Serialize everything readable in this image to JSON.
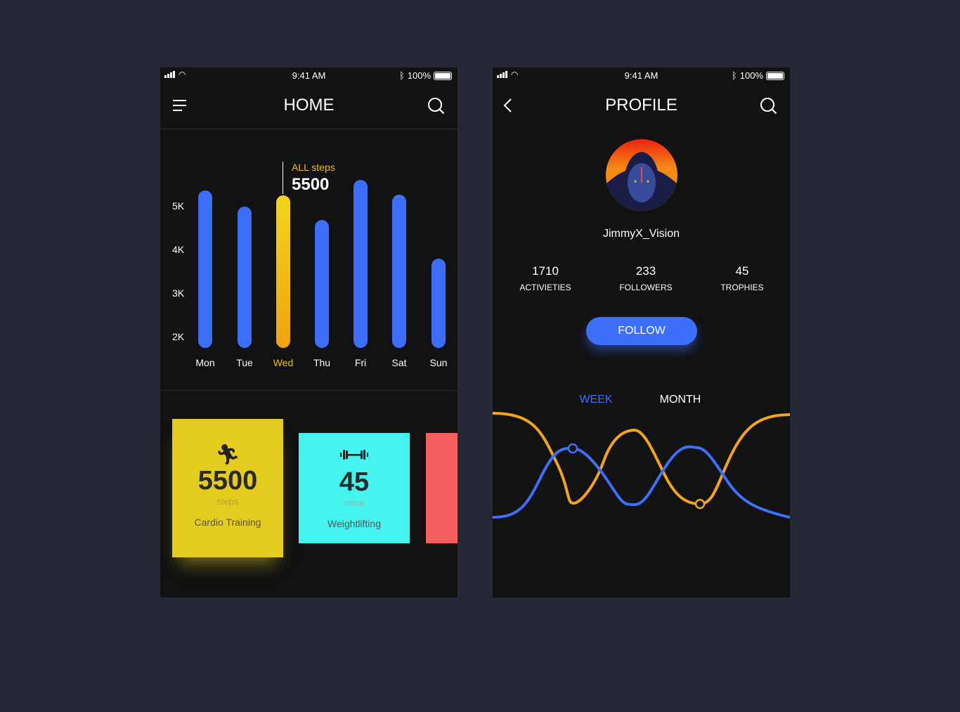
{
  "status_bar": {
    "time": "9:41 AM",
    "battery": "100%"
  },
  "home": {
    "title": "HOME",
    "chart_data": {
      "type": "bar",
      "categories": [
        "Mon",
        "Tue",
        "Wed",
        "Thu",
        "Fri",
        "Sat",
        "Sun"
      ],
      "values": [
        5370,
        5000,
        5260,
        4690,
        5610,
        5270,
        3800
      ],
      "y_ticks": [
        "5K",
        "4K",
        "3K",
        "2K"
      ],
      "ylim": [
        1750,
        6000
      ],
      "highlight_index": 2,
      "highlight_color": "#f2c014",
      "bar_color": "#3e6ffb",
      "tooltip": {
        "label": "ALL steps",
        "value": "5500"
      }
    },
    "cards": [
      {
        "icon": "running-icon",
        "value": "5500",
        "unit": "steps",
        "label": "Cardio Training",
        "color": "#e4cc1e"
      },
      {
        "icon": "dumbbell-icon",
        "value": "45",
        "unit": "mins",
        "label": "Weightlifting",
        "color": "#45f4ee"
      },
      {
        "color": "#f65f5f"
      }
    ]
  },
  "profile": {
    "title": "PROFILE",
    "username": "JimmyX_Vision",
    "stats": [
      {
        "value": "1710",
        "label": "ACTIVIETIES"
      },
      {
        "value": "233",
        "label": "FOLLOWERS"
      },
      {
        "value": "45",
        "label": "TROPHIES"
      }
    ],
    "follow_label": "FOLLOW",
    "tabs": [
      {
        "label": "WEEK",
        "active": true
      },
      {
        "label": "MONTH",
        "active": false
      }
    ],
    "accent": "#3e6ffb",
    "line2_color": "#f2a41e"
  }
}
